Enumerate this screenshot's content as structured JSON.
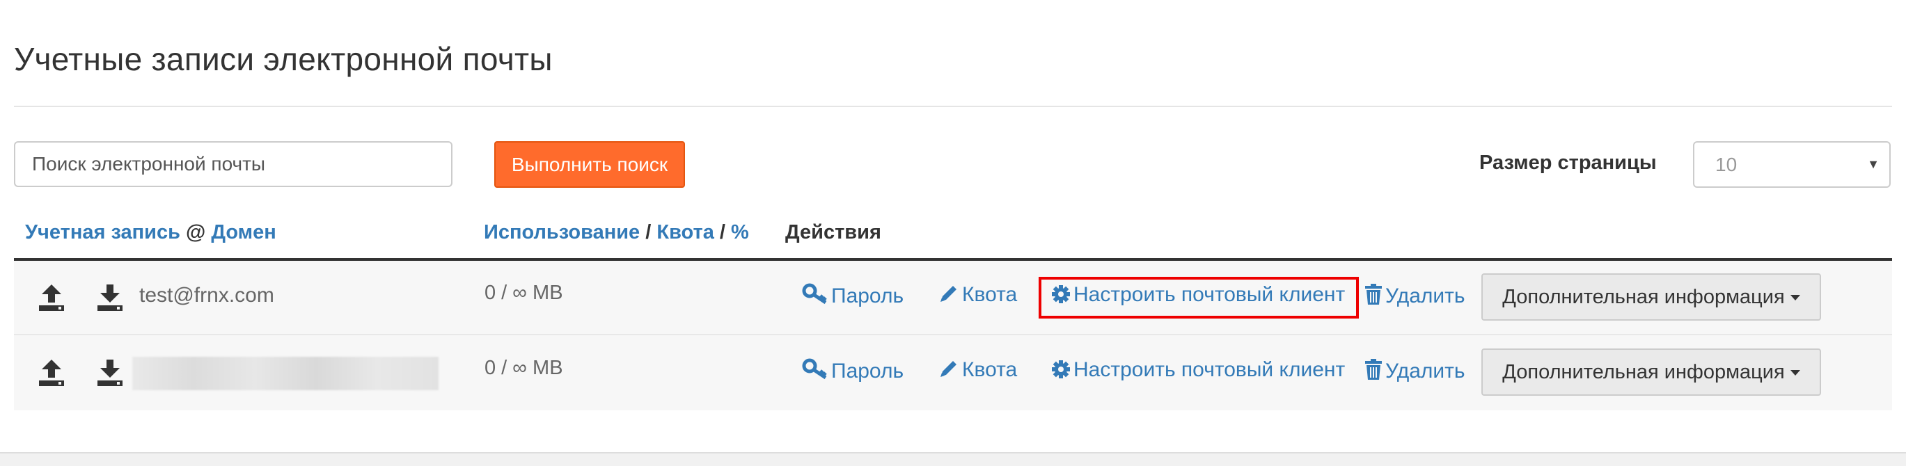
{
  "page": {
    "title": "Учетные записи электронной почты"
  },
  "search": {
    "placeholder": "Поиск электронной почты",
    "button_label": "Выполнить поиск"
  },
  "page_size": {
    "label": "Размер страницы",
    "value": "10"
  },
  "table": {
    "headers": {
      "account": "Учетная запись",
      "at": "@",
      "domain": "Домен",
      "usage": "Использование",
      "sep1": "/",
      "quota": "Квота",
      "sep2": "/",
      "percent": "%",
      "actions": "Действия"
    },
    "rows": [
      {
        "email": "test@frnx.com",
        "usage": "0 / ∞ MB",
        "actions": {
          "password": "Пароль",
          "quota": "Квота",
          "configure": "Настроить почтовый клиент",
          "delete": "Удалить",
          "more": "Дополнительная информация"
        }
      },
      {
        "email": "",
        "usage": "0 / ∞ MB",
        "actions": {
          "password": "Пароль",
          "quota": "Квота",
          "configure": "Настроить почтовый клиент",
          "delete": "Удалить",
          "more": "Дополнительная информация"
        }
      }
    ]
  },
  "colors": {
    "link": "#337ab7",
    "accent_button": "#ff6b2c",
    "highlight": "#e00000"
  },
  "icons": [
    "upload-icon",
    "download-icon",
    "key-icon",
    "pencil-icon",
    "gear-icon",
    "trash-icon",
    "caret-down-icon"
  ]
}
